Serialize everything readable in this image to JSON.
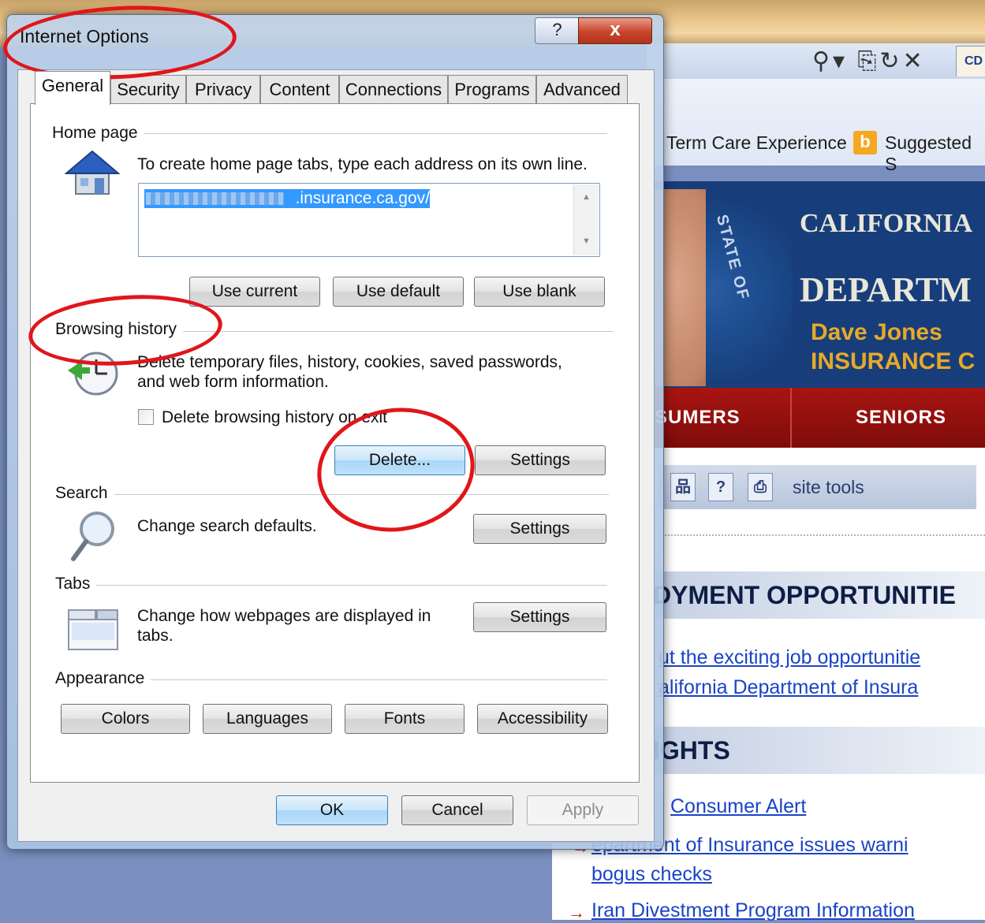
{
  "dialog": {
    "title": "Internet Options",
    "help_label": "?",
    "close_label": "x"
  },
  "tabs": [
    {
      "label": "General",
      "active": true
    },
    {
      "label": "Security",
      "active": false
    },
    {
      "label": "Privacy",
      "active": false
    },
    {
      "label": "Content",
      "active": false
    },
    {
      "label": "Connections",
      "active": false
    },
    {
      "label": "Programs",
      "active": false
    },
    {
      "label": "Advanced",
      "active": false
    }
  ],
  "home_page": {
    "heading": "Home page",
    "instruction": "To create home page tabs, type each address on its own line.",
    "address_value": ".insurance.ca.gov/",
    "use_current": "Use current",
    "use_default": "Use default",
    "use_blank": "Use blank"
  },
  "browsing_history": {
    "heading": "Browsing history",
    "description_line1": "Delete temporary files, history, cookies, saved passwords,",
    "description_line2": "and web form information.",
    "delete_on_exit_label": "Delete browsing history on exit",
    "delete_on_exit_checked": false,
    "delete_button": "Delete...",
    "settings_button": "Settings"
  },
  "search": {
    "heading": "Search",
    "description": "Change search defaults.",
    "settings_button": "Settings"
  },
  "tabs_section": {
    "heading": "Tabs",
    "description_line1": "Change how webpages are displayed in",
    "description_line2": "tabs.",
    "settings_button": "Settings"
  },
  "appearance": {
    "heading": "Appearance",
    "colors": "Colors",
    "languages": "Languages",
    "fonts": "Fonts",
    "accessibility": "Accessibility"
  },
  "footer": {
    "ok": "OK",
    "cancel": "Cancel",
    "apply": "Apply"
  },
  "background_page": {
    "tab_stub": "CD",
    "favorites": [
      "Term Care Experience",
      "Suggested S"
    ],
    "banner_line1": "CALIFORNIA",
    "banner_line2": "DEPARTM",
    "banner_name": "Dave Jones",
    "banner_role": "INSURANCE C",
    "seal_text": "STATE OF",
    "nav": [
      "SUMERS",
      "SENIORS"
    ],
    "site_tools": "site tools",
    "heading_employment": "DYMENT OPPORTUNITIE",
    "employment_link1": "ut the exciting job opportunitie",
    "employment_link2": "alifornia Department of Insura",
    "heading_highlights": "IGHTS",
    "link_consumer_alert": "Consumer Alert",
    "link_warning": "epartment of Insurance issues warni",
    "link_bogus": "bogus checks",
    "link_iran": "Iran Divestment Program Information"
  },
  "colors": {
    "accent_focus": "#3399ff",
    "annotation_red": "#e0161b",
    "close_red": "#c8452b"
  }
}
